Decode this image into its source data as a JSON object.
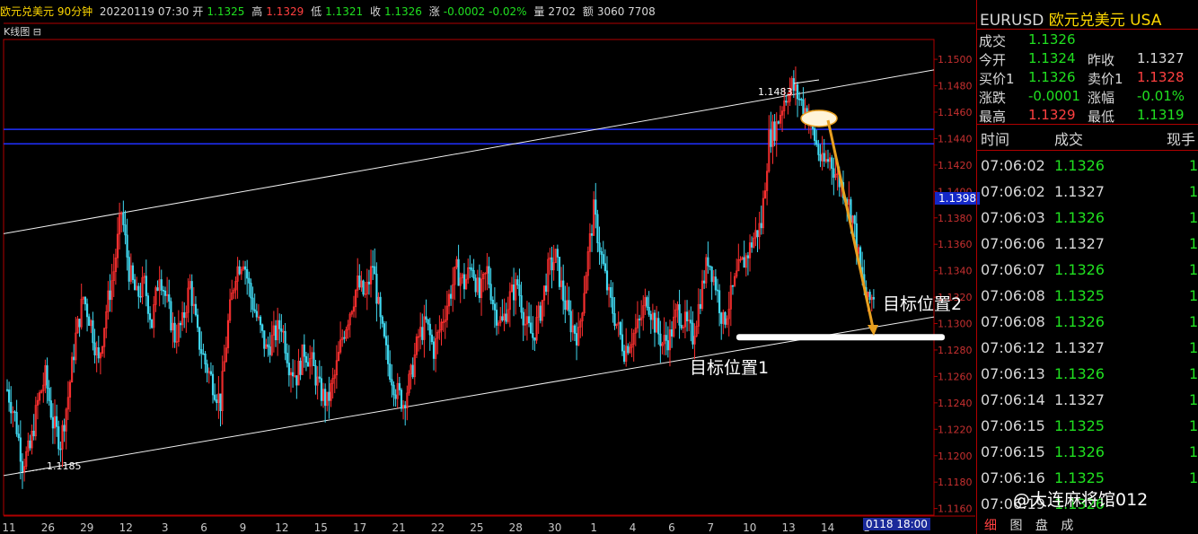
{
  "header": {
    "symbol_period": "欧元兑美元 90分钟",
    "date_time": "20220119 07:30",
    "open_label": "开",
    "open": "1.1325",
    "high_label": "高",
    "high": "1.1329",
    "low_label": "低",
    "low": "1.1321",
    "close_label": "收",
    "close": "1.1326",
    "change_label": "涨",
    "change": "-0.0002",
    "change_pct": "-0.02%",
    "volume_label": "量",
    "volume": "2702",
    "amount_label": "额",
    "amount": "3060 7708"
  },
  "chart_toolbar": {
    "label": "K线图",
    "toggle": "⊟"
  },
  "chart_data": {
    "type": "candlestick",
    "ylim": [
      1.1155,
      1.1515
    ],
    "y_ticks": [
      "1.1500",
      "1.1480",
      "1.1460",
      "1.1440",
      "1.1420",
      "1.1400",
      "1.1380",
      "1.1360",
      "1.1340",
      "1.1320",
      "1.1300",
      "1.1280",
      "1.1260",
      "1.1240",
      "1.1220",
      "1.1200",
      "1.1180",
      "1.1160"
    ],
    "x_ticks": [
      "11",
      "26",
      "29",
      "12",
      "3",
      "6",
      "9",
      "12",
      "15",
      "17",
      "21",
      "22",
      "25",
      "28",
      "30",
      "1",
      "4",
      "6",
      "7",
      "10",
      "13",
      "14",
      "1"
    ],
    "current_price": "1.1398",
    "current_date_box": "0118 18:00",
    "annotations": {
      "low_label": "1.1185",
      "high_label": "1.1483",
      "target1": "目标位置1",
      "target2": "目标位置2"
    },
    "horizontal_levels": [
      1.1447,
      1.1436
    ],
    "channel_upper": [
      [
        0,
        1.1368
      ],
      [
        1,
        1.1492
      ]
    ],
    "channel_lower": [
      [
        0,
        1.1185
      ],
      [
        1,
        1.1305
      ]
    ],
    "target1_line": 1.129,
    "path": [
      1.125,
      1.123,
      1.1195,
      1.1205,
      1.124,
      1.126,
      1.1225,
      1.121,
      1.1245,
      1.129,
      1.132,
      1.13,
      1.127,
      1.131,
      1.134,
      1.1385,
      1.134,
      1.132,
      1.133,
      1.13,
      1.134,
      1.1315,
      1.129,
      1.13,
      1.133,
      1.129,
      1.127,
      1.1255,
      1.124,
      1.13,
      1.134,
      1.135,
      1.132,
      1.13,
      1.128,
      1.129,
      1.13,
      1.127,
      1.126,
      1.128,
      1.127,
      1.125,
      1.124,
      1.126,
      1.129,
      1.131,
      1.133,
      1.132,
      1.1345,
      1.13,
      1.127,
      1.125,
      1.124,
      1.126,
      1.129,
      1.13,
      1.128,
      1.13,
      1.132,
      1.134,
      1.133,
      1.1345,
      1.132,
      1.134,
      1.131,
      1.13,
      1.132,
      1.133,
      1.13,
      1.129,
      1.131,
      1.134,
      1.135,
      1.132,
      1.13,
      1.129,
      1.134,
      1.1385,
      1.135,
      1.132,
      1.13,
      1.128,
      1.129,
      1.13,
      1.132,
      1.13,
      1.1285,
      1.129,
      1.131,
      1.13,
      1.129,
      1.132,
      1.135,
      1.133,
      1.13,
      1.132,
      1.134,
      1.135,
      1.1365,
      1.1375,
      1.144,
      1.145,
      1.147,
      1.148,
      1.147,
      1.146,
      1.144,
      1.142,
      1.1425,
      1.141,
      1.14,
      1.138,
      1.134,
      1.1315,
      1.1325
    ]
  },
  "quote_panel": {
    "symbol": "EURUSD",
    "name": "欧元兑美元",
    "market": "USA",
    "rows": [
      [
        {
          "label": "成交",
          "value": "1.1326",
          "color": "g"
        }
      ],
      [
        {
          "label": "今开",
          "value": "1.1324",
          "color": "g"
        },
        {
          "label": "昨收",
          "value": "1.1327",
          "color": "w"
        }
      ],
      [
        {
          "label": "买价1",
          "value": "1.1326",
          "color": "g"
        },
        {
          "label": "卖价1",
          "value": "1.1328",
          "color": "r"
        }
      ],
      [
        {
          "label": "涨跌",
          "value": "-0.0001",
          "color": "g"
        },
        {
          "label": "涨幅",
          "value": "-0.01%",
          "color": "g"
        }
      ],
      [
        {
          "label": "最高",
          "value": "1.1329",
          "color": "r"
        },
        {
          "label": "最低",
          "value": "1.1319",
          "color": "g"
        }
      ]
    ],
    "tick_headers": {
      "time": "时间",
      "price": "成交",
      "vol": "现手"
    },
    "ticks": [
      {
        "time": "07:06:02",
        "price": "1.1326",
        "color": "g",
        "vol": "1"
      },
      {
        "time": "07:06:02",
        "price": "1.1327",
        "color": "w",
        "vol": "1"
      },
      {
        "time": "07:06:03",
        "price": "1.1326",
        "color": "g",
        "vol": "1"
      },
      {
        "time": "07:06:06",
        "price": "1.1327",
        "color": "w",
        "vol": "1"
      },
      {
        "time": "07:06:07",
        "price": "1.1326",
        "color": "g",
        "vol": "1"
      },
      {
        "time": "07:06:08",
        "price": "1.1325",
        "color": "g",
        "vol": "1"
      },
      {
        "time": "07:06:08",
        "price": "1.1326",
        "color": "g",
        "vol": "1"
      },
      {
        "time": "07:06:12",
        "price": "1.1327",
        "color": "w",
        "vol": "1"
      },
      {
        "time": "07:06:13",
        "price": "1.1326",
        "color": "g",
        "vol": "1"
      },
      {
        "time": "07:06:14",
        "price": "1.1327",
        "color": "w",
        "vol": "1"
      },
      {
        "time": "07:06:15",
        "price": "1.1325",
        "color": "g",
        "vol": "1"
      },
      {
        "time": "07:06:15",
        "price": "1.1326",
        "color": "g",
        "vol": "1"
      },
      {
        "time": "07:06:16",
        "price": "1.1325",
        "color": "g",
        "vol": "1"
      },
      {
        "time": "07:06:19",
        "price": "1.1326",
        "color": "g",
        "vol": ""
      }
    ],
    "tabs": [
      "细",
      "图",
      "盘",
      "成"
    ]
  },
  "watermark": "@大连麻将馆012",
  "colors": {
    "up": "#ff3030",
    "down": "#40d8f0",
    "axis": "#b00000",
    "level": "#2030ff",
    "arrow": "#e8a020",
    "green": "#20e020"
  }
}
